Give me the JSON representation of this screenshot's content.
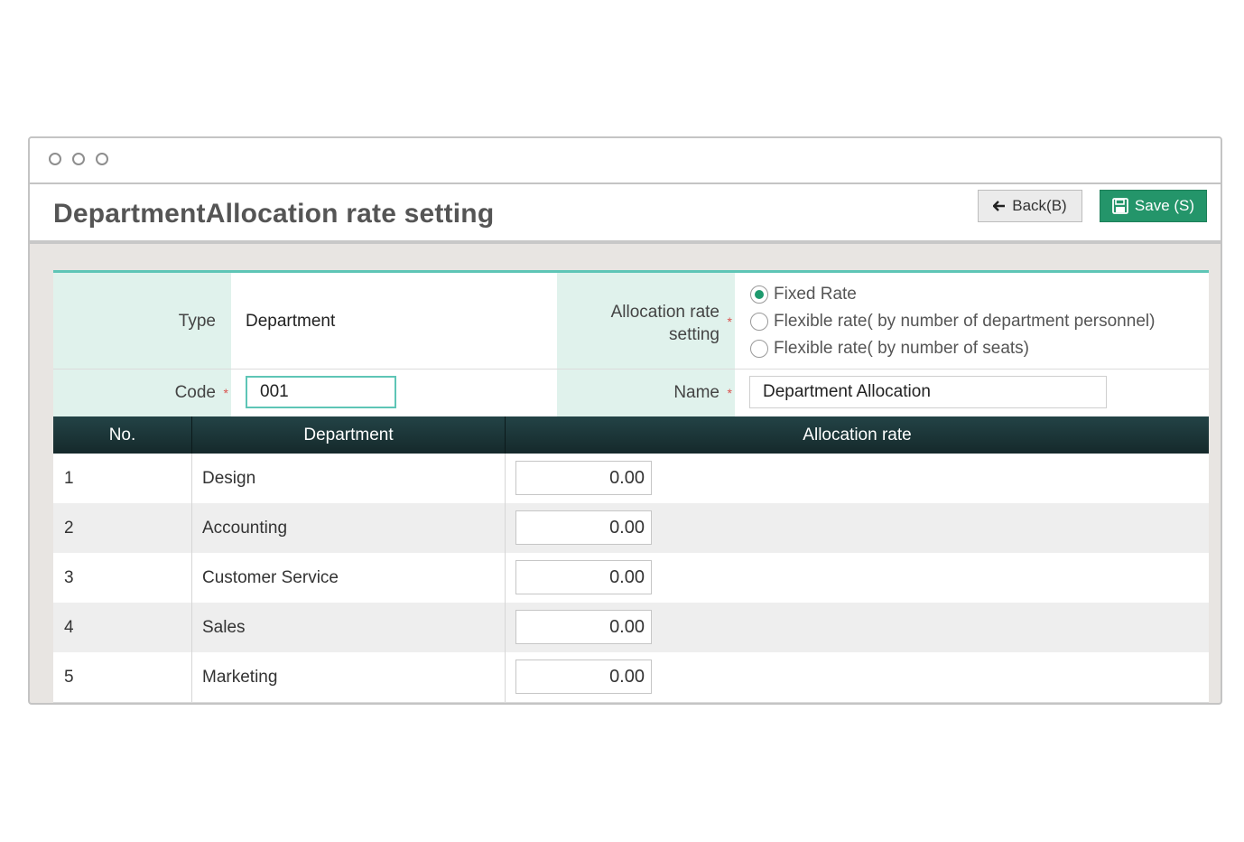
{
  "window": {
    "controls": [
      "close",
      "minimize",
      "maximize"
    ]
  },
  "header": {
    "title": "DepartmentAllocation rate setting",
    "back_label": "Back(B)",
    "save_label": "Save (S)"
  },
  "form": {
    "type_label": "Type",
    "type_value": "Department",
    "allocation_label_line1": "Allocation rate",
    "allocation_label_line2": "setting",
    "allocation_options": [
      {
        "label": "Fixed Rate",
        "selected": true
      },
      {
        "label": "Flexible rate( by number of department personnel)",
        "selected": false
      },
      {
        "label": "Flexible rate( by number of seats)",
        "selected": false
      }
    ],
    "code_label": "Code",
    "code_value": "001",
    "name_label": "Name",
    "name_value": "Department Allocation",
    "required_mark": "*"
  },
  "table": {
    "headers": [
      "No.",
      "Department",
      "Allocation rate"
    ],
    "rows": [
      {
        "no": "1",
        "department": "Design",
        "rate": "0.00"
      },
      {
        "no": "2",
        "department": "Accounting",
        "rate": "0.00"
      },
      {
        "no": "3",
        "department": "Customer Service",
        "rate": "0.00"
      },
      {
        "no": "4",
        "department": "Sales",
        "rate": "0.00"
      },
      {
        "no": "5",
        "department": "Marketing",
        "rate": "0.00"
      }
    ]
  },
  "colors": {
    "accent": "#24956a",
    "label_background": "#e0f2ec",
    "table_header": "#1d3a3c",
    "card_top_border": "#5ec5b6"
  }
}
